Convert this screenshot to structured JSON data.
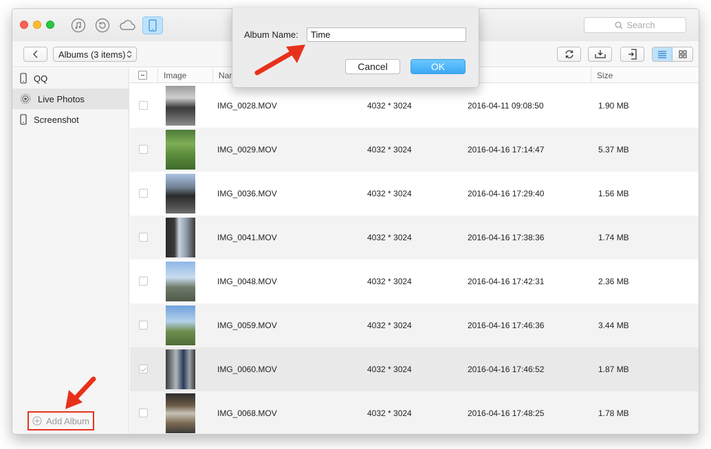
{
  "toolbar": {
    "album_select": "Albums (3 items)",
    "search_placeholder": "Search"
  },
  "sidebar": {
    "items": [
      {
        "label": "QQ",
        "icon": "phone-icon"
      },
      {
        "label": "Live Photos",
        "icon": "live-photo-icon"
      },
      {
        "label": "Screenshot",
        "icon": "phone-icon"
      }
    ],
    "add_album": "Add Album"
  },
  "table": {
    "columns": {
      "image": "Image",
      "name": "Nam",
      "time": "me",
      "size": "Size"
    },
    "rows": [
      {
        "name": "IMG_0028.MOV",
        "resolution": "4032 * 3024",
        "time": "2016-04-11 09:08:50",
        "size": "1.90 MB",
        "checked": false
      },
      {
        "name": "IMG_0029.MOV",
        "resolution": "4032 * 3024",
        "time": "2016-04-16 17:14:47",
        "size": "5.37 MB",
        "checked": false
      },
      {
        "name": "IMG_0036.MOV",
        "resolution": "4032 * 3024",
        "time": "2016-04-16 17:29:40",
        "size": "1.56 MB",
        "checked": false
      },
      {
        "name": "IMG_0041.MOV",
        "resolution": "4032 * 3024",
        "time": "2016-04-16 17:38:36",
        "size": "1.74 MB",
        "checked": false
      },
      {
        "name": "IMG_0048.MOV",
        "resolution": "4032 * 3024",
        "time": "2016-04-16 17:42:31",
        "size": "2.36 MB",
        "checked": false
      },
      {
        "name": "IMG_0059.MOV",
        "resolution": "4032 * 3024",
        "time": "2016-04-16 17:46:36",
        "size": "3.44 MB",
        "checked": false
      },
      {
        "name": "IMG_0060.MOV",
        "resolution": "4032 * 3024",
        "time": "2016-04-16 17:46:52",
        "size": "1.87 MB",
        "checked": true
      },
      {
        "name": "IMG_0068.MOV",
        "resolution": "4032 * 3024",
        "time": "2016-04-16 17:48:25",
        "size": "1.78 MB",
        "checked": false
      }
    ]
  },
  "dialog": {
    "label": "Album Name:",
    "value": "Time",
    "cancel": "Cancel",
    "ok": "OK"
  },
  "colors": {
    "accent_blue": "#3ba9f5",
    "annotation_red": "#e8311b"
  }
}
